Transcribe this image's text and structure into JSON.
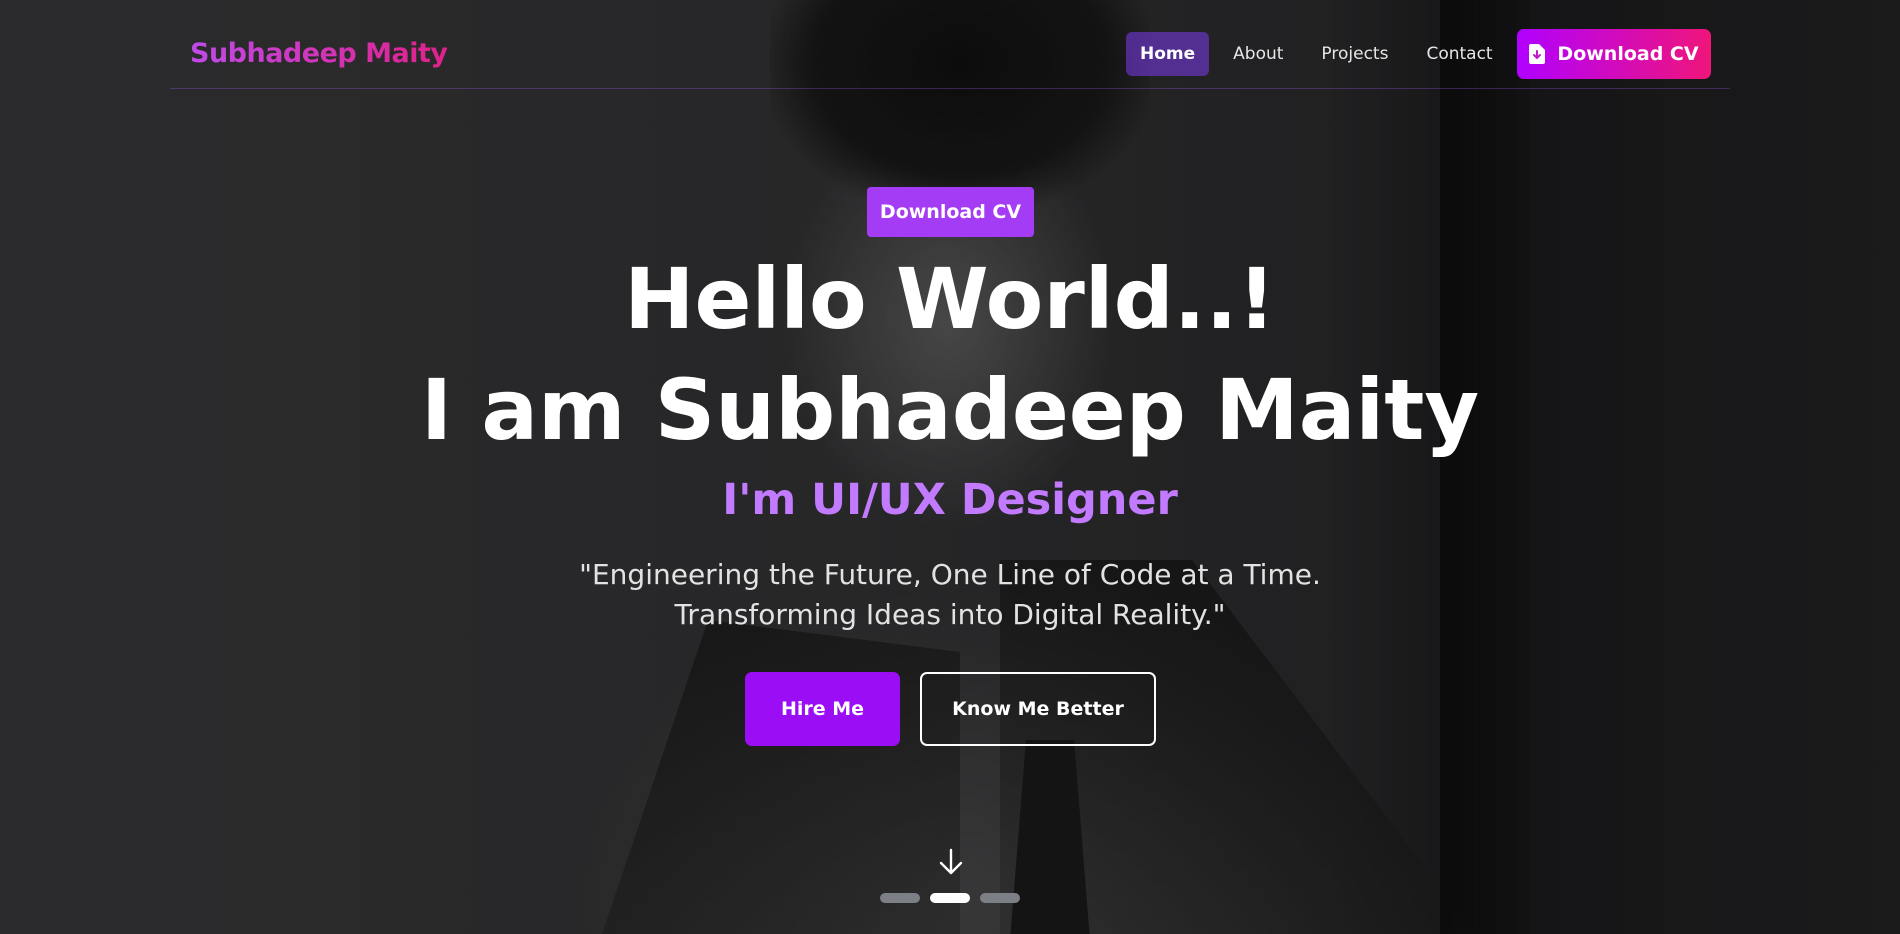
{
  "nav": {
    "brand": "Subhadeep Maity",
    "links": [
      {
        "label": "Home",
        "active": true
      },
      {
        "label": "About",
        "active": false
      },
      {
        "label": "Projects",
        "active": false
      },
      {
        "label": "Contact",
        "active": false
      }
    ],
    "cta": {
      "label": "Download CV",
      "icon": "file-download-icon"
    }
  },
  "hero": {
    "badge": "Download CV",
    "headline_1": "Hello World..!",
    "headline_2": "I am Subhadeep Maity",
    "role": "I'm UI/UX Designer",
    "quote_1": "\"Engineering the Future, One Line of Code at a Time.",
    "quote_2": "Transforming Ideas into Digital Reality.\"",
    "primary_button": "Hire Me",
    "secondary_button": "Know Me Better",
    "scroll_icon": "arrow-down-icon",
    "slider": {
      "count": 3,
      "active_index": 1
    }
  },
  "colors": {
    "brand_gradient_start": "#c04ae8",
    "brand_gradient_end": "#e0218a",
    "accent": "#9a0df5",
    "role_text": "#c27bff",
    "badge": "#a43cf5"
  }
}
